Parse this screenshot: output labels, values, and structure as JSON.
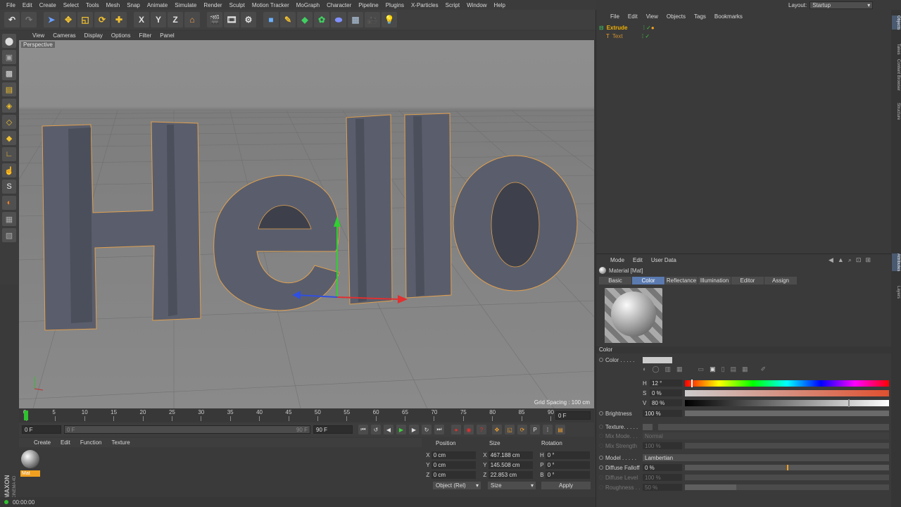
{
  "menubar": [
    "File",
    "Edit",
    "Create",
    "Select",
    "Tools",
    "Mesh",
    "Snap",
    "Animate",
    "Simulate",
    "Render",
    "Sculpt",
    "Motion Tracker",
    "MoGraph",
    "Character",
    "Pipeline",
    "Plugins",
    "X-Particles",
    "Script",
    "Window",
    "Help"
  ],
  "layout": {
    "label": "Layout:",
    "value": "Startup"
  },
  "toolbar": {
    "x_axis": "X",
    "y_axis": "Y",
    "z_axis": "Z"
  },
  "view_menu": [
    "View",
    "Cameras",
    "Display",
    "Options",
    "Filter",
    "Panel"
  ],
  "viewport": {
    "label": "Perspective",
    "grid_spacing": "Grid Spacing : 100 cm",
    "scene_text": "Hello"
  },
  "timeline": {
    "ticks": [
      "0",
      "5",
      "10",
      "15",
      "20",
      "25",
      "30",
      "35",
      "40",
      "45",
      "50",
      "55",
      "60",
      "65",
      "70",
      "75",
      "80",
      "85",
      "90"
    ],
    "current_frame": "0 F",
    "start": "0 F",
    "range_start": "0 F",
    "range_end": "90 F",
    "end": "90 F"
  },
  "material_menu": [
    "Create",
    "Edit",
    "Function",
    "Texture"
  ],
  "material": {
    "name": "Mat"
  },
  "coords": {
    "headers": {
      "position": "Position",
      "size": "Size",
      "rotation": "Rotation"
    },
    "rows": [
      {
        "axis": "X",
        "pos": "0 cm",
        "size_axis": "X",
        "size": "467.188 cm",
        "rot_axis": "H",
        "rot": "0 °"
      },
      {
        "axis": "Y",
        "pos": "0 cm",
        "size_axis": "Y",
        "size": "145.508 cm",
        "rot_axis": "P",
        "rot": "0 °"
      },
      {
        "axis": "Z",
        "pos": "0 cm",
        "size_axis": "Z",
        "size": "22.853 cm",
        "rot_axis": "B",
        "rot": "0 °"
      }
    ],
    "mode": "Object (Rel)",
    "size_mode": "Size",
    "apply": "Apply"
  },
  "status": {
    "time": "00:00:00"
  },
  "object_menu": [
    "File",
    "Edit",
    "View",
    "Objects",
    "Tags",
    "Bookmarks"
  ],
  "objects": [
    {
      "name": "Extrude",
      "color": "#f0b000"
    },
    {
      "name": "Text",
      "color": "#d09030"
    }
  ],
  "attr_menu": [
    "Mode",
    "Edit",
    "User Data"
  ],
  "attr": {
    "title": "Material [Mat]",
    "tabs": [
      "Basic",
      "Color",
      "Reflectance",
      "Illumination",
      "Editor",
      "Assign"
    ],
    "active_tab": "Color",
    "section": "Color",
    "color_label": "Color . . . . .",
    "hsv": {
      "h_label": "H",
      "h": "12 °",
      "s_label": "S",
      "s": "0 %",
      "v_label": "V",
      "v": "80 %"
    },
    "brightness": {
      "label": "Brightness",
      "value": "100 %"
    },
    "texture": {
      "label": "Texture. . . . ."
    },
    "mix_mode": {
      "label": "Mix Mode. . .",
      "value": "Normal"
    },
    "mix_strength": {
      "label": "Mix Strength",
      "value": "100 %"
    },
    "model": {
      "label": "Model . . . . .",
      "value": "Lambertian"
    },
    "diffuse_falloff": {
      "label": "Diffuse Falloff",
      "value": "0 %"
    },
    "diffuse_level": {
      "label": "Diffuse Level",
      "value": "100 %"
    },
    "roughness": {
      "label": "Roughness . .",
      "value": "50 %"
    }
  },
  "right_tabs": [
    "Objects",
    "Takes",
    "Content Browser",
    "Structure",
    "Attributes",
    "Layers"
  ],
  "colors": {
    "accent_tab": "#5a7ab0",
    "selection_orange": "#f0a020",
    "timeline_marker": "#30c030"
  }
}
